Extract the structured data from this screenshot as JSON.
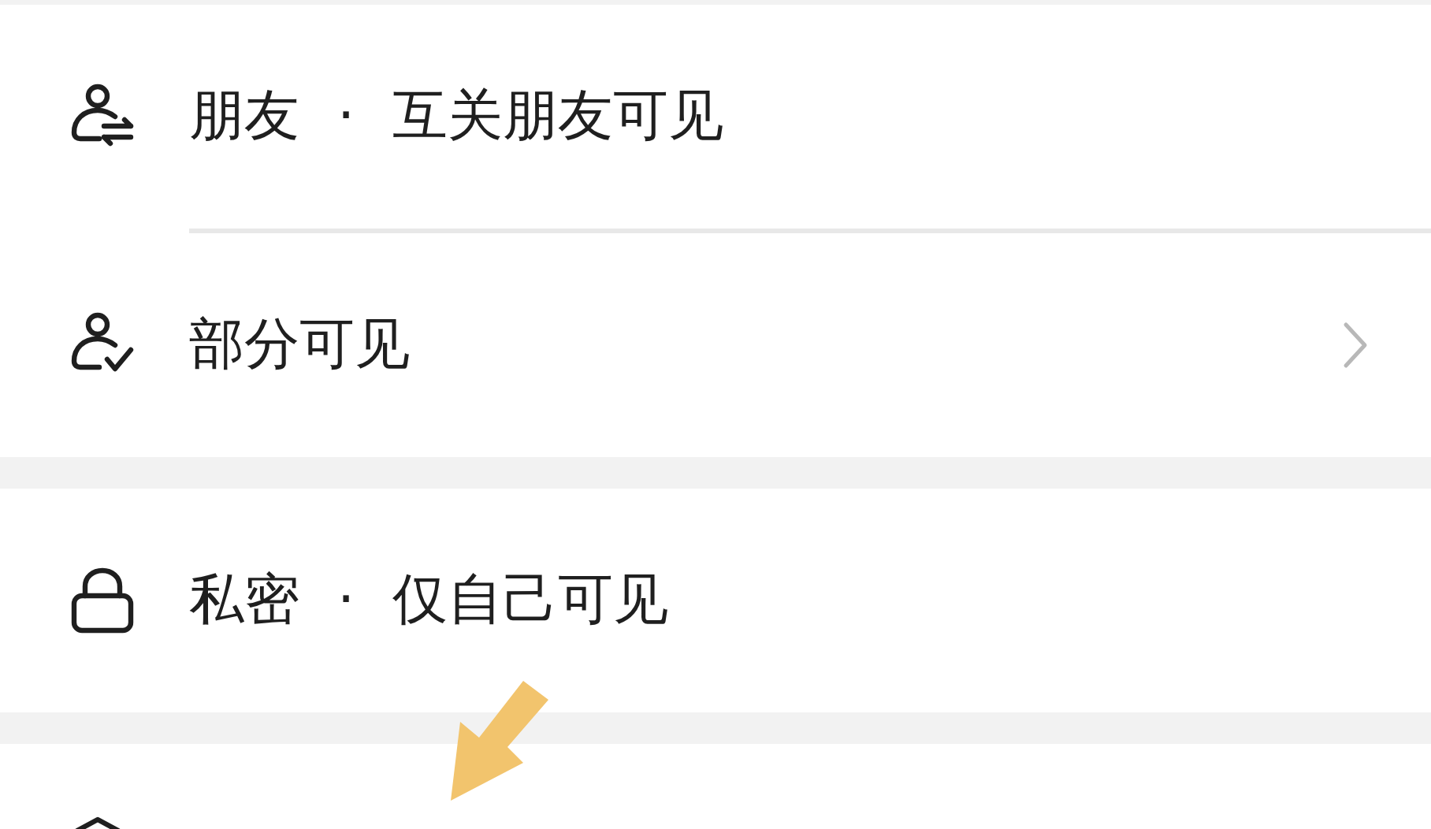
{
  "groups": [
    {
      "items": [
        {
          "kind": "friends",
          "label": "朋友",
          "separator": "·",
          "detail": "互关朋友可见",
          "chevron": false
        },
        {
          "kind": "partial",
          "label": "部分可见",
          "chevron": true
        }
      ]
    },
    {
      "items": [
        {
          "kind": "private",
          "label": "私密",
          "separator": "·",
          "detail": "仅自己可见",
          "chevron": false
        }
      ]
    },
    {
      "items": [
        {
          "kind": "cutoff"
        }
      ]
    }
  ]
}
